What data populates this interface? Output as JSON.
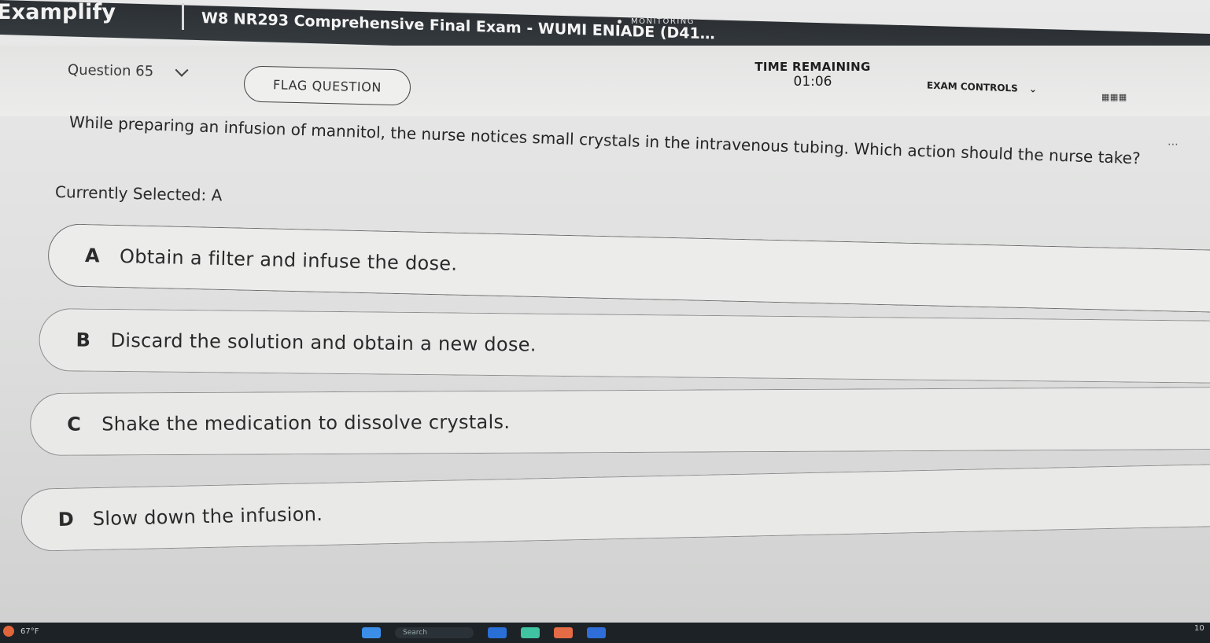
{
  "header": {
    "brand": "Examplify",
    "exam_title": "W8 NR293 Comprehensive Final Exam - WUMI ENIADE (D412773...",
    "monitoring": "MONITORING",
    "time_label": "TIME REMAINING",
    "time_value": "01:06",
    "exam_controls": "EXAM CONTROLS"
  },
  "question_bar": {
    "question_label": "Question 65",
    "flag_label": "FLAG QUESTION"
  },
  "question": {
    "text": "While preparing an infusion of mannitol, the nurse notices small crystals in the intravenous tubing. Which action should the nurse take?",
    "currently_selected": "Currently Selected: A"
  },
  "options": [
    {
      "letter": "A",
      "text": "Obtain a filter and infuse the dose."
    },
    {
      "letter": "B",
      "text": "Discard the solution and obtain a new dose."
    },
    {
      "letter": "C",
      "text": "Shake the medication to dissolve crystals."
    },
    {
      "letter": "D",
      "text": "Slow down the infusion."
    }
  ],
  "taskbar": {
    "weather": "67°F",
    "search": "Search",
    "icon_colors": [
      "#3b8ee8",
      "#2a6fd6",
      "#3fc3a1",
      "#e36b46",
      "#2f6ed8"
    ]
  },
  "colors": {
    "header_bg": "#2c3034",
    "page_bg": "#e4e4e3",
    "option_border": "#8c8c8c"
  }
}
